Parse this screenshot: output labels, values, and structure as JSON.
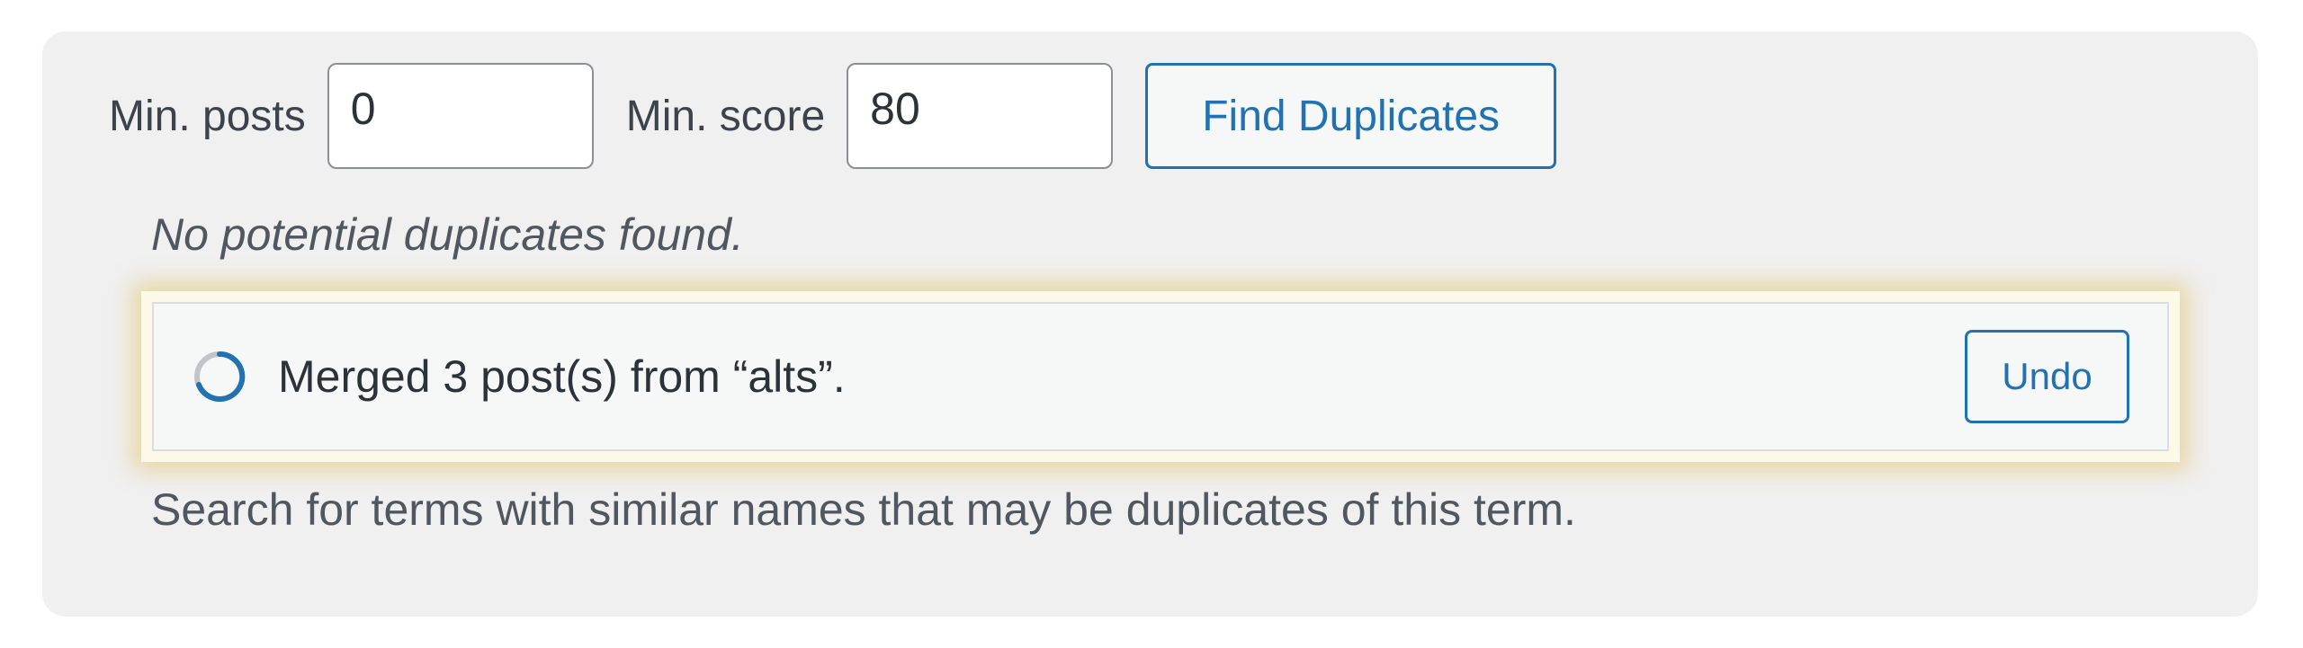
{
  "controls": {
    "min_posts_label": "Min. posts",
    "min_posts_value": "0",
    "min_score_label": "Min. score",
    "min_score_value": "80",
    "find_button_label": "Find Duplicates"
  },
  "status_message": "No potential duplicates found.",
  "notice": {
    "text": "Merged 3 post(s) from “alts”.",
    "undo_label": "Undo",
    "spinner_icon": "spinner-icon"
  },
  "description": "Search for terms with similar names that may be duplicates of this term.",
  "colors": {
    "accent": "#2271b1",
    "panel_bg": "#f0f0f1",
    "notice_highlight": "#dba617"
  }
}
